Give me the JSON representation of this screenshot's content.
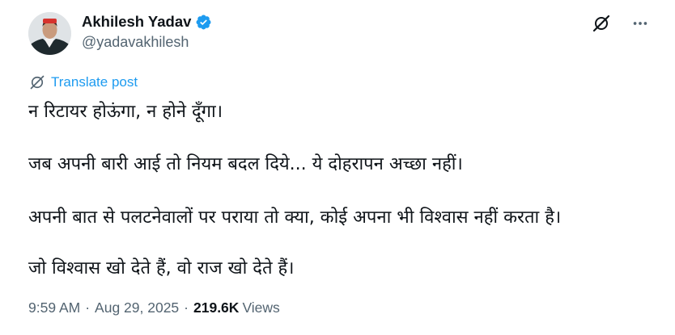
{
  "author": {
    "name": "Akhilesh Yadav",
    "handle": "@yadavakhilesh"
  },
  "translate": {
    "label": "Translate post"
  },
  "post": {
    "lines": [
      "न रिटायर होऊंगा, न होने दूँगा।",
      "जब अपनी बारी आई तो नियम बदल दिये... ये दोहरापन अच्छा नहीं।",
      "अपनी बात से पलटनेवालों पर पराया तो क्या, कोई अपना भी विश्वास नहीं करता है।",
      "जो विश्वास खो देते हैं, वो राज खो देते हैं।"
    ]
  },
  "meta": {
    "time": "9:59 AM",
    "separator": "·",
    "date": "Aug 29, 2025",
    "views_count": "219.6K",
    "views_label": "Views"
  },
  "icons": {
    "verified": "verified-badge-icon",
    "grok": "grok-icon",
    "more": "more-options-icon",
    "translate": "translate-icon"
  },
  "colors": {
    "accent": "#1d9bf0",
    "secondary_text": "#536471",
    "primary_text": "#0f1419"
  }
}
